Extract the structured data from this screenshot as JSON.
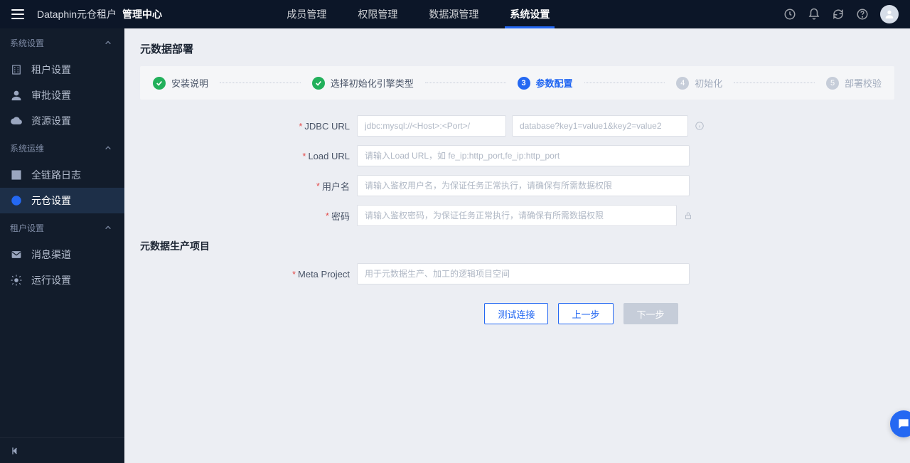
{
  "brand": {
    "part1": "Dataphin元仓租户",
    "part2": "管理中心"
  },
  "topnav": [
    {
      "label": "成员管理"
    },
    {
      "label": "权限管理"
    },
    {
      "label": "数据源管理"
    },
    {
      "label": "系统设置",
      "active": true
    }
  ],
  "sidebar": {
    "groups": [
      {
        "title": "系统设置",
        "items": [
          {
            "label": "租户设置",
            "icon": "building"
          },
          {
            "label": "审批设置",
            "icon": "user"
          },
          {
            "label": "资源设置",
            "icon": "cloud"
          }
        ]
      },
      {
        "title": "系统运维",
        "items": [
          {
            "label": "全链路日志",
            "icon": "list"
          },
          {
            "label": "元仓设置",
            "icon": "ring",
            "active": true
          }
        ]
      },
      {
        "title": "租户设置",
        "items": [
          {
            "label": "消息渠道",
            "icon": "mail"
          },
          {
            "label": "运行设置",
            "icon": "gear"
          }
        ]
      }
    ]
  },
  "page": {
    "title": "元数据部署"
  },
  "steps": [
    {
      "label": "安装说明",
      "state": "done"
    },
    {
      "label": "选择初始化引擎类型",
      "state": "done"
    },
    {
      "label": "参数配置",
      "state": "current",
      "num": "3"
    },
    {
      "label": "初始化",
      "state": "pending",
      "num": "4"
    },
    {
      "label": "部署校验",
      "state": "pending",
      "num": "5"
    }
  ],
  "form": {
    "jdbc_label": "JDBC URL",
    "jdbc_prefix_placeholder": "jdbc:mysql://<Host>:<Port>/",
    "jdbc_suffix_placeholder": "database?key1=value1&key2=value2",
    "loadurl_label": "Load URL",
    "loadurl_placeholder": "请输入Load URL，如 fe_ip:http_port,fe_ip:http_port",
    "user_label": "用户名",
    "user_placeholder": "请输入鉴权用户名，为保证任务正常执行，请确保有所需数据权限",
    "pass_label": "密码",
    "pass_placeholder": "请输入鉴权密码，为保证任务正常执行，请确保有所需数据权限",
    "section2": "元数据生产项目",
    "meta_label": "Meta Project",
    "meta_placeholder": "用于元数据生产、加工的逻辑项目空间"
  },
  "buttons": {
    "test": "测试连接",
    "prev": "上一步",
    "next": "下一步"
  }
}
